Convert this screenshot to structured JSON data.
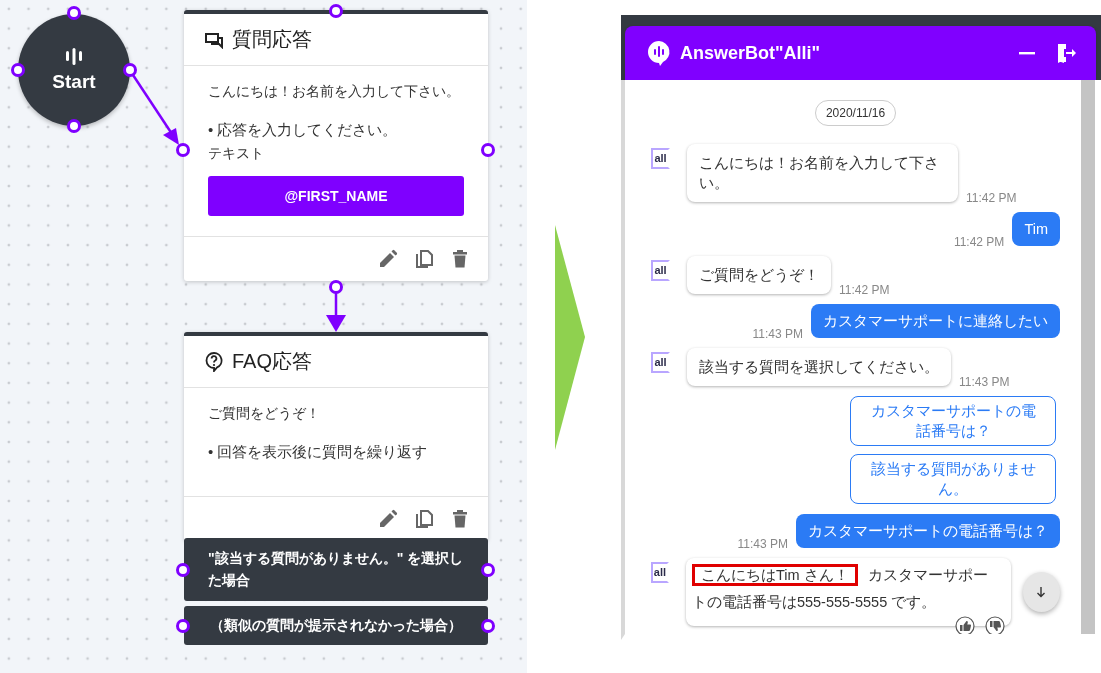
{
  "canvas": {
    "start_node": {
      "label": "Start"
    },
    "nodes": [
      {
        "kind": "question",
        "title": "質問応答",
        "message": "こんにちは！お名前を入力して下さい。",
        "item": "• 応答を入力してください。",
        "field_label": "テキスト",
        "variable": "@FIRST_NAME"
      },
      {
        "kind": "faq",
        "title": "FAQ応答",
        "message": "ご質問をどうぞ！",
        "item": "• 回答を表示後に質問を繰り返す"
      }
    ],
    "conditions": [
      "\"該当する質問がありません。\" を選択した場合",
      "（類似の質問が提示されなかった場合）"
    ]
  },
  "chat": {
    "title": "AnswerBot\"Alli\"",
    "date": "2020/11/16",
    "messages": [
      {
        "kind": "bot",
        "avatar": "all",
        "text": "こんにちは！お名前を入力して下さい。",
        "time": "11:42 PM"
      },
      {
        "kind": "user",
        "text": "Tim",
        "time": "11:42 PM"
      },
      {
        "kind": "bot",
        "avatar": "all",
        "text": "ご質問をどうぞ！",
        "time": "11:42 PM"
      },
      {
        "kind": "user",
        "text": "カスタマーサポートに連絡したい",
        "time": "11:43 PM"
      },
      {
        "kind": "bot",
        "avatar": "all",
        "text": "該当する質問を選択してください。",
        "time": "11:43 PM"
      },
      {
        "kind": "options",
        "options": [
          "カスタマーサポートの電話番号は？",
          "該当する質問がありません。"
        ]
      },
      {
        "kind": "user",
        "text": "カスタマーサポートの電話番号は？",
        "time": "11:43 PM"
      },
      {
        "kind": "answer",
        "avatar": "all",
        "highlight": "こんにちはTim さん！",
        "text": "カスタマーサポートの電話番号は555-555-5555 です。"
      }
    ]
  }
}
